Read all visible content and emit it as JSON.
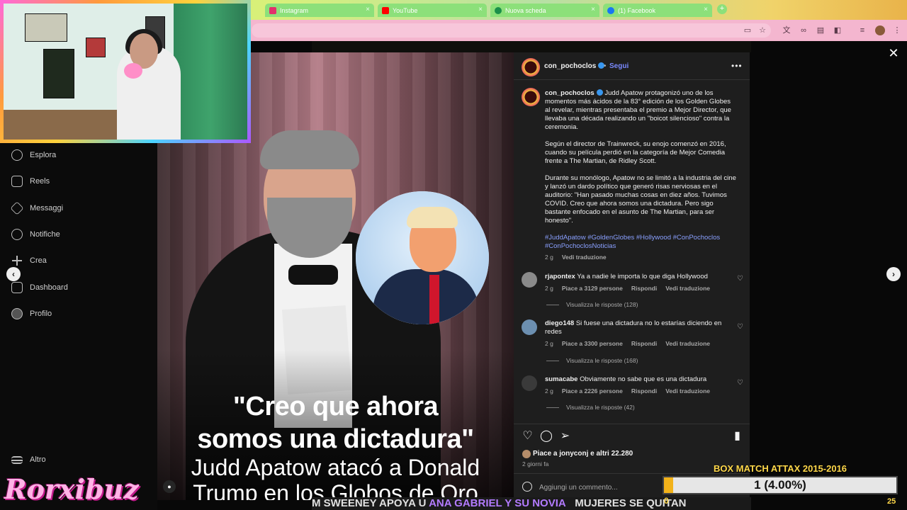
{
  "browser": {
    "tabs": [
      {
        "label": "Instagram",
        "fav_color": "#e1306c"
      },
      {
        "label": "YouTube",
        "fav_color": "#ff0000"
      },
      {
        "label": "Nuova scheda",
        "fav_color": "#1a8f4a"
      },
      {
        "label": "(1) Facebook",
        "fav_color": "#1877f2"
      }
    ],
    "new_tab": "+",
    "close_glyph": "×"
  },
  "sidebar": {
    "items": [
      {
        "label": "Esplora",
        "icon": "compass-icon"
      },
      {
        "label": "Reels",
        "icon": "reels-icon"
      },
      {
        "label": "Messaggi",
        "icon": "send-icon"
      },
      {
        "label": "Notifiche",
        "icon": "heart-icon"
      },
      {
        "label": "Crea",
        "icon": "plus-icon"
      },
      {
        "label": "Dashboard",
        "icon": "chart-icon"
      },
      {
        "label": "Profilo",
        "icon": "profile-icon"
      }
    ],
    "more": "Altro"
  },
  "post": {
    "caption_line1": "\"Creo que ahora",
    "caption_line2": "somos una dictadura\"",
    "caption_line3": "Judd Apatow atacó a Donald",
    "caption_line4": "Trump en los Globos de Oro",
    "header": {
      "username": "con_pochoclos",
      "separator": "•",
      "follow": "Segui",
      "more": "•••"
    },
    "caption": {
      "username": "con_pochoclos",
      "p1": "Judd Apatow protagonizó uno de los momentos más ácidos de la 83° edición de los Golden Globes al revelar, mientras presentaba el premio a Mejor Director, que llevaba una década realizando un \"boicot silencioso\" contra la ceremonia.",
      "p2": "Según el director de Trainwreck, su enojo comenzó en 2016, cuando su película perdió en la categoría de Mejor Comedia frente a The Martian, de Ridley Scott.",
      "p3": "Durante su monólogo, Apatow no se limitó a la industria del cine y lanzó un dardo político que generó risas nerviosas en el auditorio: \"Han pasado muchas cosas en diez años. Tuvimos COVID. Creo que ahora somos una dictadura. Pero sigo bastante enfocado en el asunto de The Martian, para ser honesto\".",
      "hashtags": "#JuddApatow #GoldenGlobes #Hollywood #ConPochoclos #ConPochoclosNoticias",
      "time": "2 g",
      "translate": "Vedi traduzione"
    },
    "comments": [
      {
        "user": "rjapontex",
        "text": "Ya a nadie le importa lo que diga Hollywood",
        "time": "2 g",
        "likes": "Piace a 3129 persone",
        "reply": "Rispondi",
        "translate": "Vedi traduzione",
        "replies": "Visualizza le risposte (128)"
      },
      {
        "user": "diego148",
        "text": "Si fuese una dictadura no lo estarías diciendo en redes",
        "time": "2 g",
        "likes": "Piace a 3300 persone",
        "reply": "Rispondi",
        "translate": "Vedi traduzione",
        "replies": "Visualizza le risposte (168)"
      },
      {
        "user": "sumacabe",
        "text": "Obviamente no sabe que es una dictadura",
        "time": "2 g",
        "likes": "Piace a 2226 persone",
        "reply": "Rispondi",
        "translate": "Vedi traduzione",
        "replies": "Visualizza le risposte (42)"
      }
    ],
    "likes_text": "Piace a jonyconj e altri 22.280",
    "ago": "2 giorni fa",
    "comment_placeholder": "Aggiungi un commento..."
  },
  "overlay": {
    "brand": "Rorxibuz",
    "ticker_a": "M SWEENEY APOYA U",
    "ticker_b": "ANA GABRIEL Y SU NOVIA",
    "ticker_c": "MUJERES SE QUITAN",
    "box_title": "BOX MATCH ATTAX 2015-2016",
    "box_value": "1 (4.00%)",
    "box_progress": 0.04,
    "box_min": "0",
    "box_max": "25"
  }
}
